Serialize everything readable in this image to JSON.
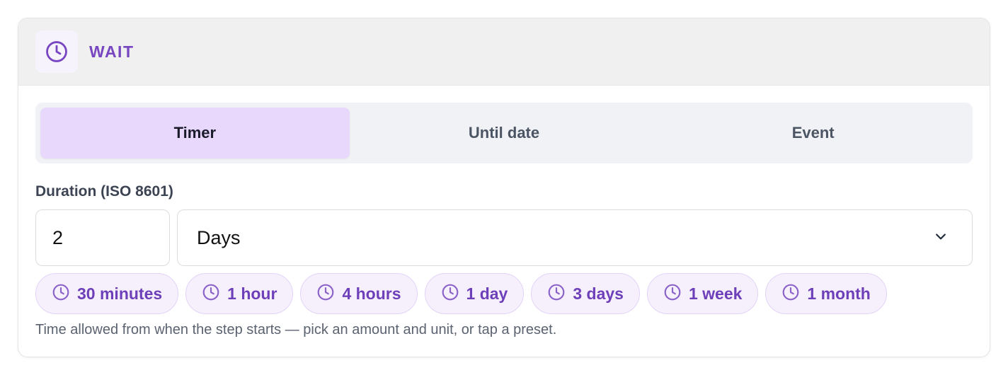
{
  "header": {
    "title": "WAIT",
    "icon": "clock-icon",
    "accent": "#7746c0"
  },
  "tabs": [
    {
      "label": "Timer",
      "active": true
    },
    {
      "label": "Until date",
      "active": false
    },
    {
      "label": "Event",
      "active": false
    }
  ],
  "duration": {
    "label": "Duration (ISO 8601)",
    "amount": "2",
    "unit": "Days",
    "unit_icon": "chevron-down-icon"
  },
  "presets": [
    {
      "label": "30 minutes",
      "icon": "clock-icon"
    },
    {
      "label": "1 hour",
      "icon": "clock-icon"
    },
    {
      "label": "4 hours",
      "icon": "clock-icon"
    },
    {
      "label": "1 day",
      "icon": "clock-icon"
    },
    {
      "label": "3 days",
      "icon": "clock-icon"
    },
    {
      "label": "1 week",
      "icon": "clock-icon"
    },
    {
      "label": "1 month",
      "icon": "clock-icon"
    }
  ],
  "hint": "Time allowed from when the step starts — pick an amount and unit, or tap a preset."
}
